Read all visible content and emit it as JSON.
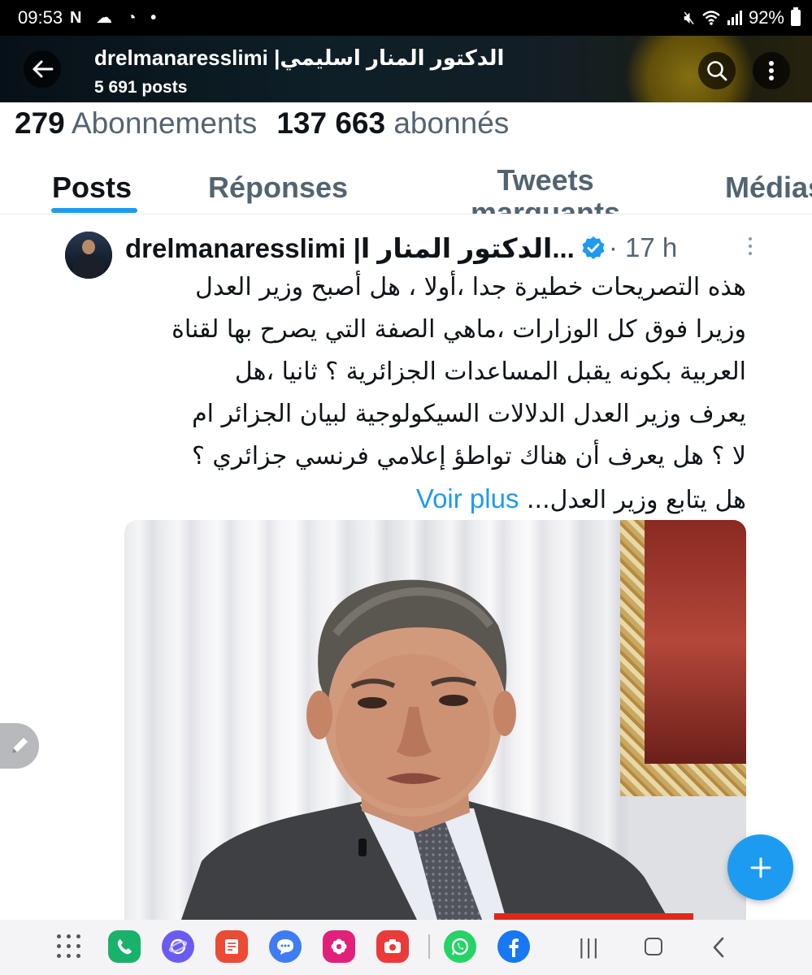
{
  "status_bar": {
    "time": "09:53",
    "left_icons": "N ☁ ◔ •",
    "battery": "92%"
  },
  "header": {
    "name": "drelmanaresslimi |الدكتور المنار اسليمي",
    "posts_count": "5 691 posts",
    "back_icon": "arrow-left-icon",
    "search_icon": "search-icon",
    "more_icon": "more-vertical-icon"
  },
  "profile": {
    "following_count": "279",
    "following_label": "Abonnements",
    "followers_count": "137 663",
    "followers_label": "abonnés"
  },
  "tabs": [
    {
      "label": "Posts",
      "active": true
    },
    {
      "label": "Réponses",
      "active": false
    },
    {
      "label": "Tweets marquants",
      "active": false
    },
    {
      "label": "Médias",
      "active": false
    }
  ],
  "tweet": {
    "author": "drelmanaresslimi |الدكتور المنار ا...",
    "verified": true,
    "time": "· 17 h",
    "text_lines": [
      "هذه التصريحات خطيرة جدا ،أولا ، هل أصبح وزير العدل",
      "وزيرا فوق كل الوزارات ،ماهي الصفة التي يصرح بها لقناة",
      "العربية بكونه يقبل المساعدات الجزائرية  ؟ ثانيا ،هل",
      "يعرف وزير العدل الدلالات السيكولوجية لبيان الجزائر ام",
      "لا ؟ هل يعرف أن هناك تواطؤ إعلامي فرنسي جزائري ؟",
      "هل يتابع وزير العدل..."
    ],
    "voir_plus": "Voir plus"
  },
  "fab": {
    "compose_icon": "pencil-icon",
    "plus_icon": "plus-icon"
  },
  "nav_bar": {
    "apps": [
      "phone-app-icon",
      "samsung-internet-icon",
      "notes-app-icon",
      "messages-app-icon",
      "gallery-app-icon",
      "screen-recorder-icon",
      "whatsapp-icon",
      "facebook-icon"
    ],
    "system": [
      "recents-icon",
      "home-icon",
      "back-icon"
    ]
  },
  "colors": {
    "accent": "#1d9bf0",
    "text": "#0f1419",
    "secondary": "#536471"
  }
}
